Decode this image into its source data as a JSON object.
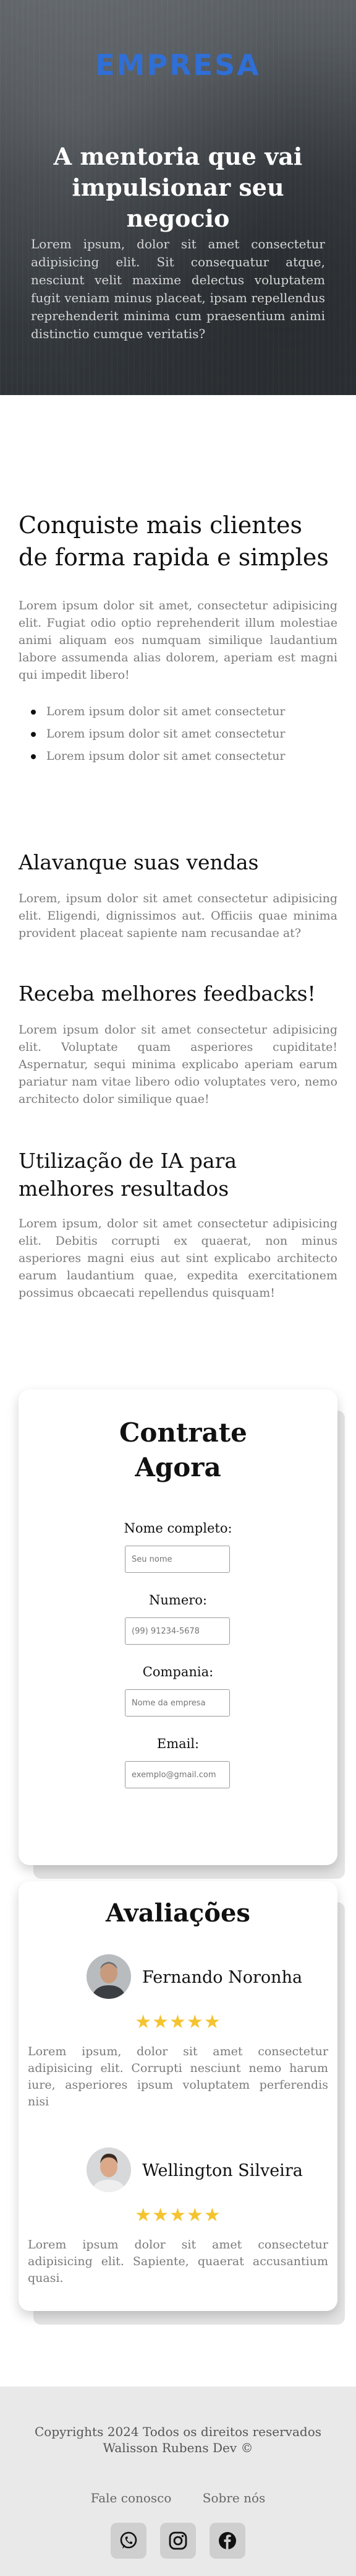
{
  "hero": {
    "brand": "EMPRESA",
    "title": "A mentoria que vai impulsionar seu negocio",
    "text": "Lorem ipsum, dolor sit amet consectetur adipisicing elit. Sit consequatur atque, nesciunt velit maxime delectus voluptatem fugit veniam minus placeat, ipsam repellendus reprehenderit minima cum praesentium animi distinctio cumque veritatis?"
  },
  "intro": {
    "title": "Conquiste mais clientes de forma rapida e simples",
    "text": "Lorem ipsum dolor sit amet, consectetur adipisicing elit. Fugiat odio optio reprehenderit illum molestiae animi aliquam eos numquam similique laudantium labore assumenda alias dolorem, aperiam est magni qui impedit libero!",
    "bullets": [
      "Lorem ipsum dolor sit amet consectetur",
      "Lorem ipsum dolor sit amet consectetur",
      "Lorem ipsum dolor sit amet consectetur"
    ]
  },
  "features": [
    {
      "title": "Alavanque suas vendas",
      "text": "Lorem, ipsum dolor sit amet consectetur adipisicing elit. Eligendi, dignissimos aut. Officiis quae minima provident placeat sapiente nam recusandae at?"
    },
    {
      "title": "Receba melhores feedbacks!",
      "text": "Lorem ipsum dolor sit amet consectetur adipisicing elit. Voluptate quam asperiores cupiditate! Aspernatur, sequi minima explicabo aperiam earum pariatur nam vitae libero odio voluptates vero, nemo architecto dolor similique quae!"
    },
    {
      "title": "Utilização de IA para melhores resultados",
      "text": "Lorem ipsum, dolor sit amet consectetur adipisicing elit. Debitis corrupti ex quaerat, non minus asperiores magni eius aut sint explicabo architecto earum laudantium quae, expedita exercitationem possimus obcaecati repellendus quisquam!"
    }
  ],
  "contact": {
    "title": "Contrate Agora",
    "fields": [
      {
        "label": "Nome completo:",
        "placeholder": "Seu nome"
      },
      {
        "label": "Numero:",
        "placeholder": "(99) 91234-5678"
      },
      {
        "label": "Compania:",
        "placeholder": "Nome da empresa"
      },
      {
        "label": "Email:",
        "placeholder": "exemplo@gmail.com"
      }
    ]
  },
  "reviews": {
    "title": "Avaliações",
    "items": [
      {
        "name": "Fernando Noronha",
        "stars": "★★★★★",
        "rating": 5,
        "text": "Lorem ipsum, dolor sit amet consectetur adipisicing elit. Corrupti nesciunt nemo harum iure, asperiores ipsum voluptatem perferendis nisi"
      },
      {
        "name": "Wellington Silveira",
        "stars": "★★★★★",
        "rating": 5,
        "text": "Lorem ipsum dolor sit amet consectetur adipisicing elit. Sapiente, quaerat accusantium quasi."
      }
    ]
  },
  "footer": {
    "copyright_line1": "Copyrights 2024 Todos os direitos reservados",
    "copyright_line2": "Walisson Rubens Dev ©",
    "links": [
      "Fale conosco",
      "Sobre nós"
    ],
    "socials": [
      "whatsapp-icon",
      "instagram-icon",
      "facebook-icon"
    ]
  },
  "colors": {
    "brand": "#2f6fd6",
    "star": "#f4c430",
    "footer_bg": "#e9e9e9"
  }
}
